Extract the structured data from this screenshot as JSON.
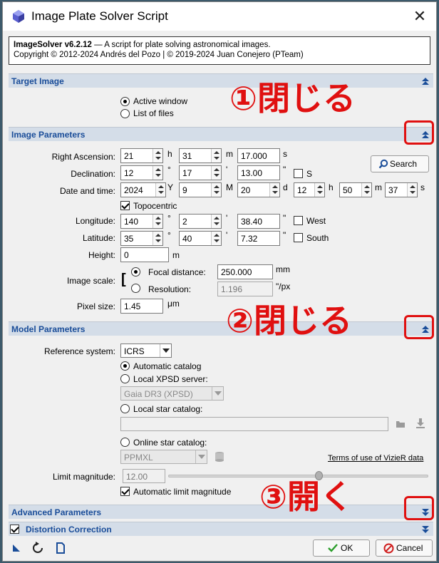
{
  "window": {
    "title": "Image Plate Solver Script",
    "close": "✕"
  },
  "info": {
    "name": "ImageSolver v6.2.12",
    "desc": " — A script for plate solving astronomical images.",
    "copyright": "Copyright © 2012-2024 Andrés del Pozo | © 2019-2024 Juan Conejero (PTeam)"
  },
  "sections": {
    "target": "Target Image",
    "image": "Image Parameters",
    "model": "Model Parameters",
    "advanced": "Advanced Parameters",
    "distortion": "Distortion Correction"
  },
  "target": {
    "active": "Active window",
    "list": "List of files",
    "selected": "active"
  },
  "image_params": {
    "ra_label": "Right Ascension:",
    "ra_h": "21",
    "ra_m": "31",
    "ra_s": "17.000",
    "ra_u1": "h",
    "ra_u2": "m",
    "ra_u3": "s",
    "dec_label": "Declination:",
    "dec_d": "12",
    "dec_m": "17",
    "dec_s": "13.00",
    "dec_u1": "°",
    "dec_u2": "'",
    "dec_u3": "\"",
    "dec_south": "S",
    "search": "Search",
    "date_label": "Date and time:",
    "year": "2024",
    "month": "9",
    "day": "20",
    "hour": "12",
    "minute": "50",
    "second": "37",
    "u_Y": "Y",
    "u_M": "M",
    "u_d": "d",
    "u_h": "h",
    "u_m": "m",
    "u_s": "s",
    "topocentric": "Topocentric",
    "topocentric_checked": true,
    "lon_label": "Longitude:",
    "lon_d": "140",
    "lon_m": "2",
    "lon_s": "38.40",
    "west": "West",
    "lat_label": "Latitude:",
    "lat_d": "35",
    "lat_m": "40",
    "lat_s": "7.32",
    "south": "South",
    "height_label": "Height:",
    "height": "0",
    "height_unit": "m",
    "scale_label": "Image scale:",
    "focal_label": "Focal distance:",
    "focal": "250.000",
    "focal_unit": "mm",
    "resolution_label": "Resolution:",
    "resolution": "1.196",
    "resolution_unit": "\"/px",
    "pixel_label": "Pixel size:",
    "pixel": "1.45",
    "pixel_unit": "μm"
  },
  "model": {
    "ref_label": "Reference system:",
    "ref": "ICRS",
    "auto_catalog": "Automatic catalog",
    "local_xpsd": "Local XPSD server:",
    "xpsd_value": "Gaia DR3 (XPSD)",
    "local_star": "Local star catalog:",
    "online_star": "Online star catalog:",
    "online_value": "PPMXL",
    "terms": "Terms of use of VizieR data",
    "limit_label": "Limit magnitude:",
    "limit": "12.00",
    "limit_fraction": 0.58,
    "auto_limit": "Automatic limit magnitude"
  },
  "footer": {
    "ok": "OK",
    "cancel": "Cancel"
  },
  "annotations": {
    "a1": "①閉じる",
    "a2": "②閉じる",
    "a3": "③開く"
  },
  "colors": {
    "section_text": "#1a4d99",
    "section_bg": "#d4dde8",
    "annotation": "#e01010",
    "ok_check": "#2a9d2a",
    "cancel_icon": "#d02020"
  }
}
